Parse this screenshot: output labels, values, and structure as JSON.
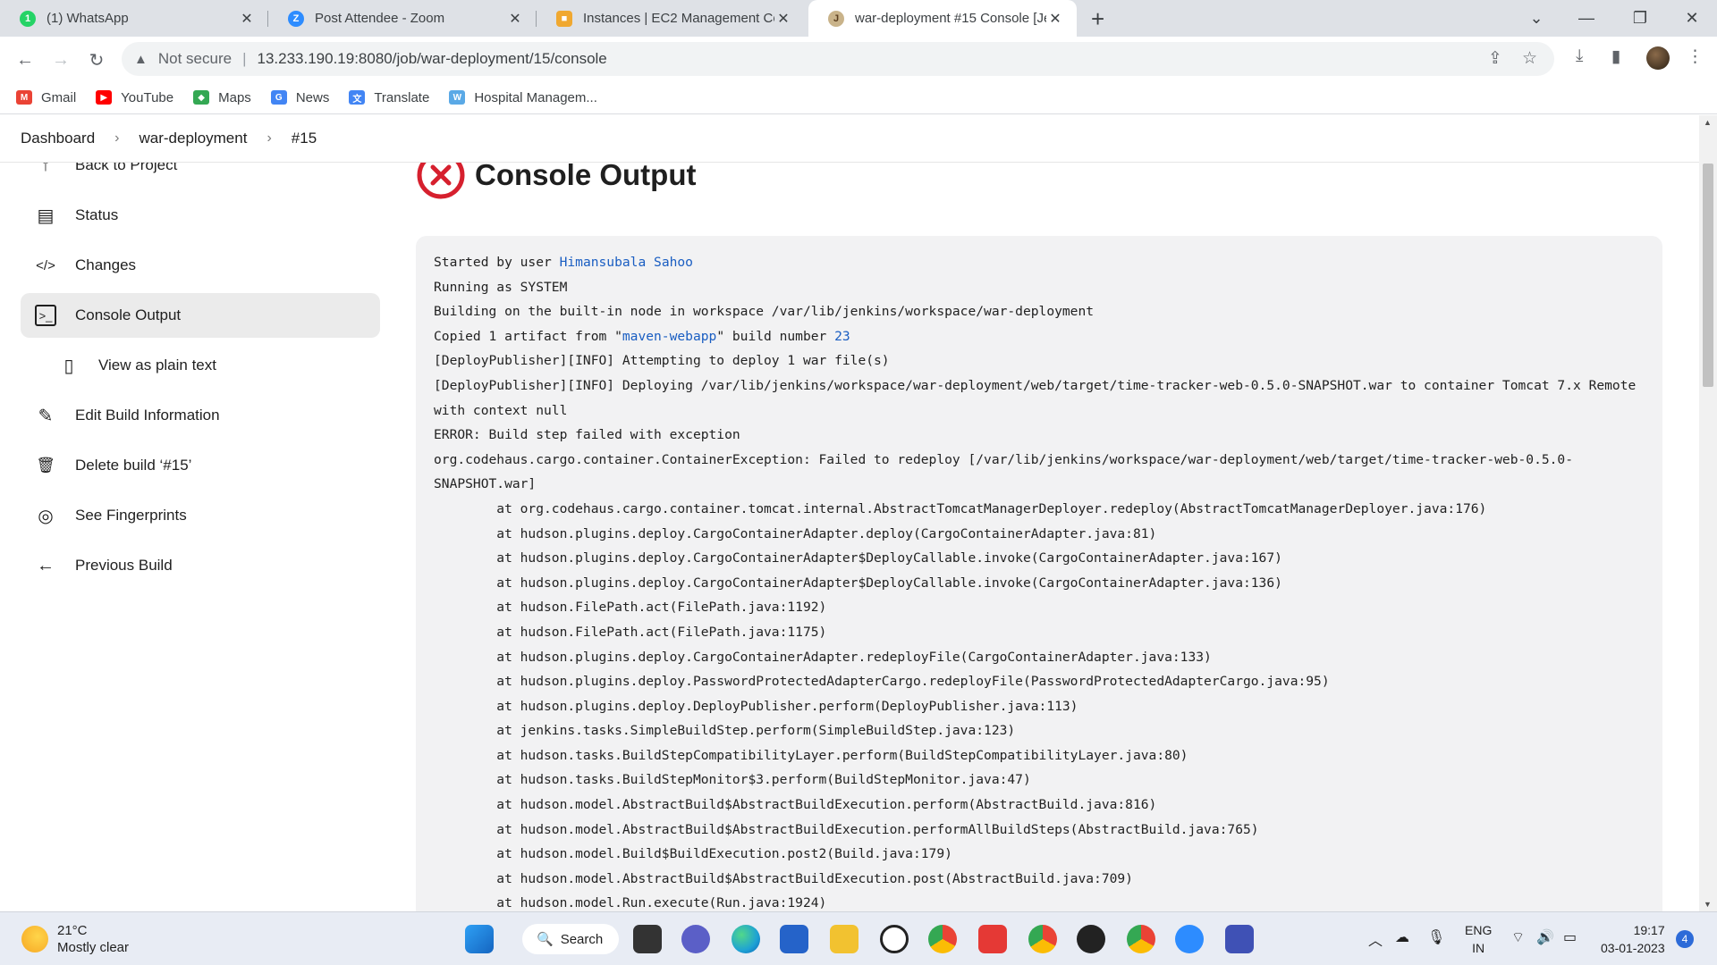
{
  "browser": {
    "tabs": [
      {
        "title": "(1) WhatsApp",
        "icon": "whatsapp-icon",
        "color": "#25d366",
        "glyph": "1"
      },
      {
        "title": "Post Attendee - Zoom",
        "icon": "zoom-icon",
        "color": "#2d8cff",
        "glyph": "Z"
      },
      {
        "title": "Instances | EC2 Management Cor",
        "icon": "aws-box-icon",
        "color": "#f0a830",
        "glyph": "■"
      },
      {
        "title": "war-deployment #15 Console [Je",
        "icon": "jenkins-icon",
        "color": "#c9b38a",
        "glyph": "J"
      }
    ],
    "url_warning": "Not secure",
    "url": "13.233.190.19:8080/job/war-deployment/15/console"
  },
  "bookmarks": [
    {
      "label": "Gmail",
      "icon": "gmail-icon",
      "color": "#ea4335",
      "glyph": "M"
    },
    {
      "label": "YouTube",
      "icon": "youtube-icon",
      "color": "#ff0000",
      "glyph": "▶"
    },
    {
      "label": "Maps",
      "icon": "maps-icon",
      "color": "#34a853",
      "glyph": "◆"
    },
    {
      "label": "News",
      "icon": "news-icon",
      "color": "#4285f4",
      "glyph": "G"
    },
    {
      "label": "Translate",
      "icon": "translate-icon",
      "color": "#4285f4",
      "glyph": "文"
    },
    {
      "label": "Hospital Managem...",
      "icon": "hospital-site-icon",
      "color": "#5aa9e6",
      "glyph": "W"
    }
  ],
  "breadcrumb": [
    "Dashboard",
    "war-deployment",
    "#15"
  ],
  "sidebar": [
    {
      "label": "Back to Project",
      "icon": "arrow-up-icon",
      "glyph": "↑"
    },
    {
      "label": "Status",
      "icon": "document-icon",
      "glyph": "▤"
    },
    {
      "label": "Changes",
      "icon": "code-icon",
      "glyph": "</>"
    },
    {
      "label": "Console Output",
      "icon": "terminal-icon",
      "glyph": ">_"
    },
    {
      "label": "View as plain text",
      "icon": "file-icon",
      "glyph": "▯"
    },
    {
      "label": "Edit Build Information",
      "icon": "edit-icon",
      "glyph": "✎"
    },
    {
      "label": "Delete build ‘#15’",
      "icon": "trash-icon",
      "glyph": "🗑"
    },
    {
      "label": "See Fingerprints",
      "icon": "fingerprint-icon",
      "glyph": "◎"
    },
    {
      "label": "Previous Build",
      "icon": "arrow-left-icon",
      "glyph": "←"
    }
  ],
  "page_title": "Console Output",
  "console": {
    "started_prefix": "Started by user ",
    "started_user": "Himansubala Sahoo",
    "running": "Running as SYSTEM",
    "building": "Building on the built-in node in workspace /var/lib/jenkins/workspace/war-deployment",
    "copied_prefix": "Copied 1 artifact from \"",
    "copied_project": "maven-webapp",
    "copied_mid": "\" build number ",
    "copied_build": "23",
    "lines_after": [
      "[DeployPublisher][INFO] Attempting to deploy 1 war file(s)",
      "[DeployPublisher][INFO] Deploying /var/lib/jenkins/workspace/war-deployment/web/target/time-tracker-web-0.5.0-SNAPSHOT.war to container Tomcat 7.x Remote",
      "with context null",
      "ERROR: Build step failed with exception",
      "org.codehaus.cargo.container.ContainerException: Failed to redeploy [/var/lib/jenkins/workspace/war-deployment/web/target/time-tracker-web-0.5.0-",
      "SNAPSHOT.war]",
      "        at org.codehaus.cargo.container.tomcat.internal.AbstractTomcatManagerDeployer.redeploy(AbstractTomcatManagerDeployer.java:176)",
      "        at hudson.plugins.deploy.CargoContainerAdapter.deploy(CargoContainerAdapter.java:81)",
      "        at hudson.plugins.deploy.CargoContainerAdapter$DeployCallable.invoke(CargoContainerAdapter.java:167)",
      "        at hudson.plugins.deploy.CargoContainerAdapter$DeployCallable.invoke(CargoContainerAdapter.java:136)",
      "        at hudson.FilePath.act(FilePath.java:1192)",
      "        at hudson.FilePath.act(FilePath.java:1175)",
      "        at hudson.plugins.deploy.CargoContainerAdapter.redeployFile(CargoContainerAdapter.java:133)",
      "        at hudson.plugins.deploy.PasswordProtectedAdapterCargo.redeployFile(PasswordProtectedAdapterCargo.java:95)",
      "        at hudson.plugins.deploy.DeployPublisher.perform(DeployPublisher.java:113)",
      "        at jenkins.tasks.SimpleBuildStep.perform(SimpleBuildStep.java:123)",
      "        at hudson.tasks.BuildStepCompatibilityLayer.perform(BuildStepCompatibilityLayer.java:80)",
      "        at hudson.tasks.BuildStepMonitor$3.perform(BuildStepMonitor.java:47)",
      "        at hudson.model.AbstractBuild$AbstractBuildExecution.perform(AbstractBuild.java:816)",
      "        at hudson.model.AbstractBuild$AbstractBuildExecution.performAllBuildSteps(AbstractBuild.java:765)",
      "        at hudson.model.Build$BuildExecution.post2(Build.java:179)",
      "        at hudson.model.AbstractBuild$AbstractBuildExecution.post(AbstractBuild.java:709)",
      "        at hudson.model.Run.execute(Run.java:1924)"
    ]
  },
  "taskbar": {
    "weather_temp": "21°C",
    "weather_desc": "Mostly clear",
    "search_label": "Search",
    "lang_top": "ENG",
    "lang_bottom": "IN",
    "time": "19:17",
    "date": "03-01-2023",
    "notification_count": "4",
    "apps": [
      {
        "name": "windows-start-icon",
        "color": "#1e88e5"
      },
      {
        "name": "task-view-icon",
        "color": "#333333"
      },
      {
        "name": "teams-chat-icon",
        "color": "#5b5fc7"
      },
      {
        "name": "edge-icon",
        "color": "#1ea2d4"
      },
      {
        "name": "store-icon",
        "color": "#2563c9"
      },
      {
        "name": "file-explorer-icon",
        "color": "#f2c230"
      },
      {
        "name": "dell-icon",
        "color": "#222222"
      },
      {
        "name": "chrome-icon",
        "color": "#4caf50"
      },
      {
        "name": "anydesk-icon",
        "color": "#e53935"
      },
      {
        "name": "chrome-profile-icon",
        "color": "#43a047"
      },
      {
        "name": "media-player-icon",
        "color": "#222222"
      },
      {
        "name": "chrome-h-profile-icon",
        "color": "#2e7d32"
      },
      {
        "name": "zoom-icon",
        "color": "#2d8cff"
      },
      {
        "name": "network-app-icon",
        "color": "#3f51b5"
      }
    ]
  },
  "colors": {
    "link": "#1a5ec2",
    "error_red": "#d6202e",
    "active_nav": "#ebebeb",
    "console_bg": "#f2f2f3"
  }
}
